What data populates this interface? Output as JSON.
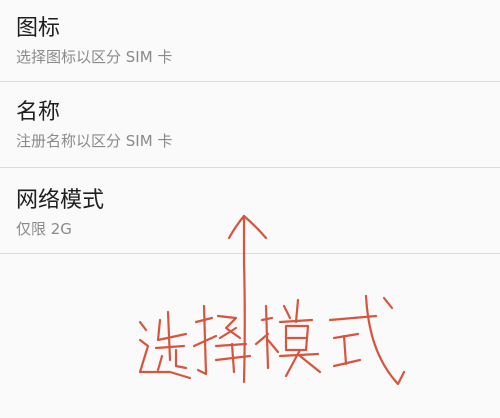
{
  "settings": {
    "items": [
      {
        "title": "图标",
        "subtitle": "选择图标以区分 SIM 卡"
      },
      {
        "title": "名称",
        "subtitle": "注册名称以区分 SIM 卡"
      },
      {
        "title": "网络模式",
        "subtitle": "仅限 2G"
      }
    ]
  },
  "annotation": {
    "handwritten_text": "选择模式",
    "ink_color": "#d9543c"
  }
}
